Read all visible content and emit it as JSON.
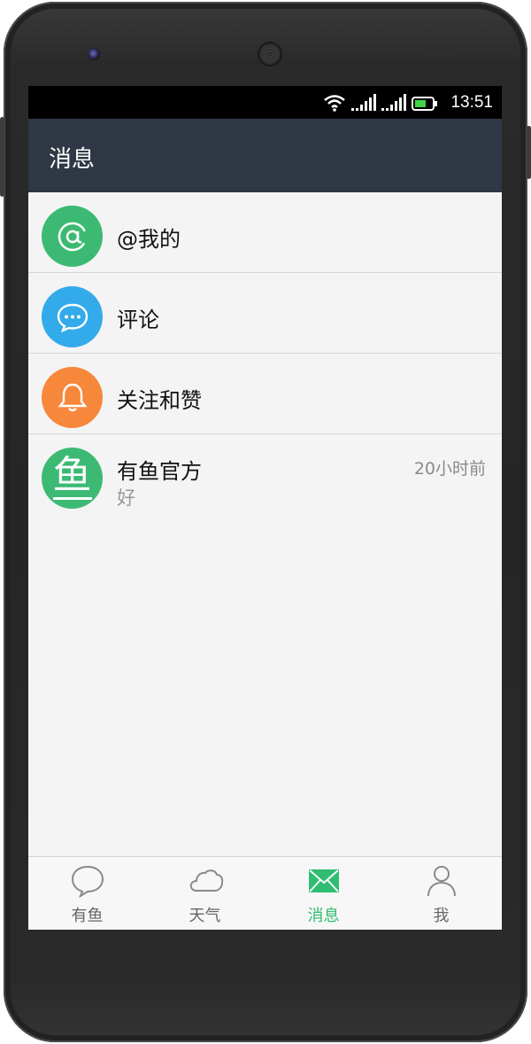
{
  "status_bar": {
    "time": "13:51"
  },
  "header": {
    "title": "消息"
  },
  "list": [
    {
      "label": "@我的",
      "icon": "at-icon",
      "color": "#3cba73"
    },
    {
      "label": "评论",
      "icon": "comment-bubble-icon",
      "color": "#33aaea"
    },
    {
      "label": "关注和赞",
      "icon": "bell-icon",
      "color": "#f7873a"
    }
  ],
  "message": {
    "avatar_char": "鱼",
    "color": "#3cba73",
    "title": "有鱼官方",
    "preview": "好",
    "time": "20小时前"
  },
  "tabs": [
    {
      "label": "有鱼",
      "icon": "speech-bubble-icon",
      "active": false
    },
    {
      "label": "天气",
      "icon": "cloud-icon",
      "active": false
    },
    {
      "label": "消息",
      "icon": "envelope-icon",
      "active": true
    },
    {
      "label": "我",
      "icon": "person-icon",
      "active": false
    }
  ]
}
